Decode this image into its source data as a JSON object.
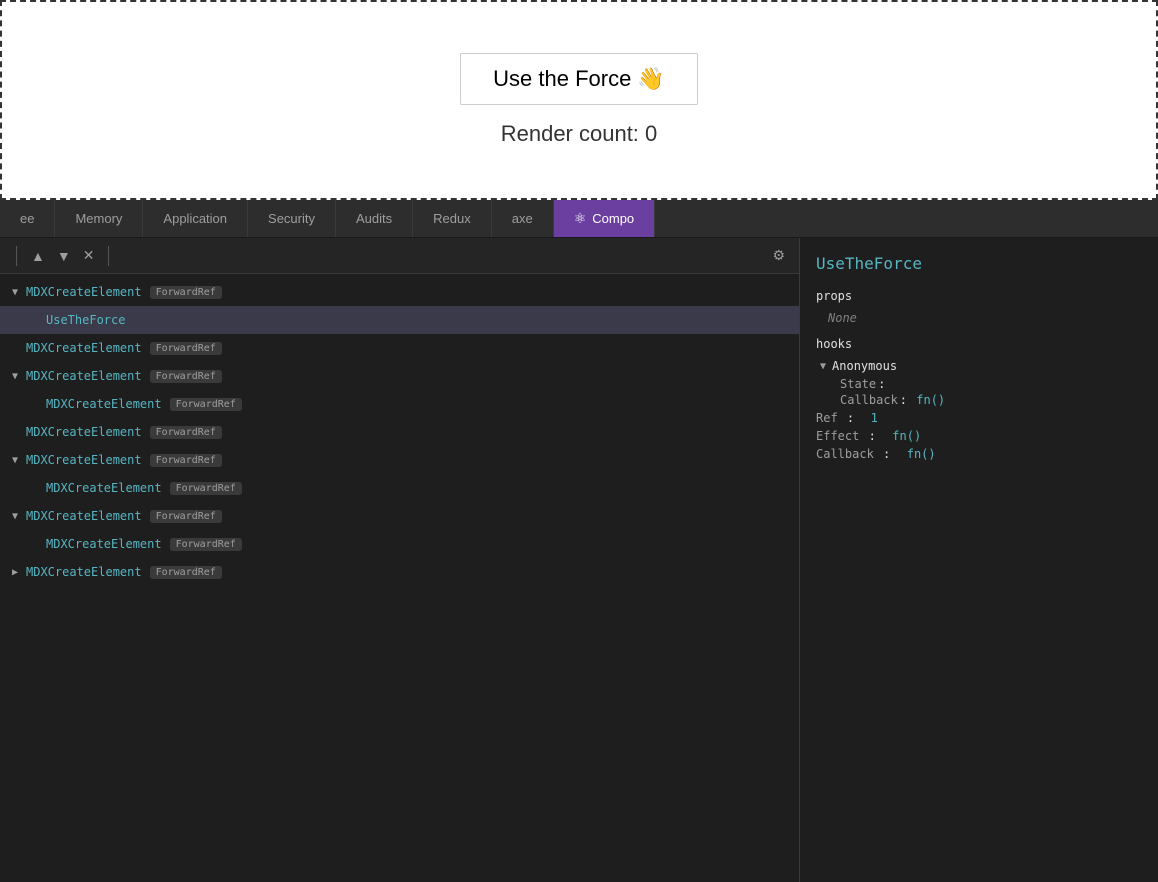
{
  "preview": {
    "button_label": "Use the Force 👋",
    "render_count_label": "Render count: 0"
  },
  "tabs": [
    {
      "id": "ee",
      "label": "ee",
      "active": false
    },
    {
      "id": "memory",
      "label": "Memory",
      "active": false
    },
    {
      "id": "application",
      "label": "Application",
      "active": false
    },
    {
      "id": "security",
      "label": "Security",
      "active": false
    },
    {
      "id": "audits",
      "label": "Audits",
      "active": false
    },
    {
      "id": "redux",
      "label": "Redux",
      "active": false
    },
    {
      "id": "axe",
      "label": "axe",
      "active": false
    },
    {
      "id": "components",
      "label": "Compo",
      "active": true,
      "icon": "react"
    }
  ],
  "toolbar": {
    "up_label": "▲",
    "down_label": "▼",
    "close_label": "✕",
    "gear_label": "⚙"
  },
  "component_title": "UseTheForce",
  "props": {
    "label": "props",
    "none_label": "None"
  },
  "hooks": {
    "label": "hooks",
    "anonymous_label": "Anonymous",
    "state_key": "State",
    "state_colon": ":",
    "callback_key": "Callback",
    "callback_value": "fn()",
    "ref_key": "Ref",
    "ref_value": "1",
    "effect_key": "Effect",
    "effect_value": "fn()",
    "callback2_key": "Callback",
    "callback2_value": "fn()"
  },
  "tree": {
    "items": [
      {
        "level": 0,
        "has_chevron": true,
        "chevron_open": true,
        "name": "MDXCreateElement",
        "badge": "ForwardRef",
        "selected": false
      },
      {
        "level": 1,
        "has_chevron": false,
        "name": "UseTheForce",
        "badge": "",
        "selected": true
      },
      {
        "level": 0,
        "has_chevron": false,
        "name": "MDXCreateElement",
        "badge": "ForwardRef",
        "selected": false
      },
      {
        "level": 0,
        "has_chevron": true,
        "chevron_open": true,
        "name": "MDXCreateElement",
        "badge": "ForwardRef",
        "selected": false
      },
      {
        "level": 1,
        "has_chevron": false,
        "name": "MDXCreateElement",
        "badge": "ForwardRef",
        "selected": false
      },
      {
        "level": 0,
        "has_chevron": false,
        "name": "MDXCreateElement",
        "badge": "ForwardRef",
        "selected": false
      },
      {
        "level": 0,
        "has_chevron": true,
        "chevron_open": true,
        "name": "MDXCreateElement",
        "badge": "ForwardRef",
        "selected": false
      },
      {
        "level": 1,
        "has_chevron": false,
        "name": "MDXCreateElement",
        "badge": "ForwardRef",
        "selected": false
      },
      {
        "level": 0,
        "has_chevron": true,
        "chevron_open": true,
        "name": "MDXCreateElement",
        "badge": "ForwardRef",
        "selected": false
      },
      {
        "level": 1,
        "has_chevron": false,
        "name": "MDXCreateElement",
        "badge": "ForwardRef",
        "selected": false
      },
      {
        "level": 0,
        "has_chevron": true,
        "chevron_open": false,
        "name": "MDXCreateElement",
        "badge": "ForwardRef",
        "selected": false
      }
    ]
  }
}
